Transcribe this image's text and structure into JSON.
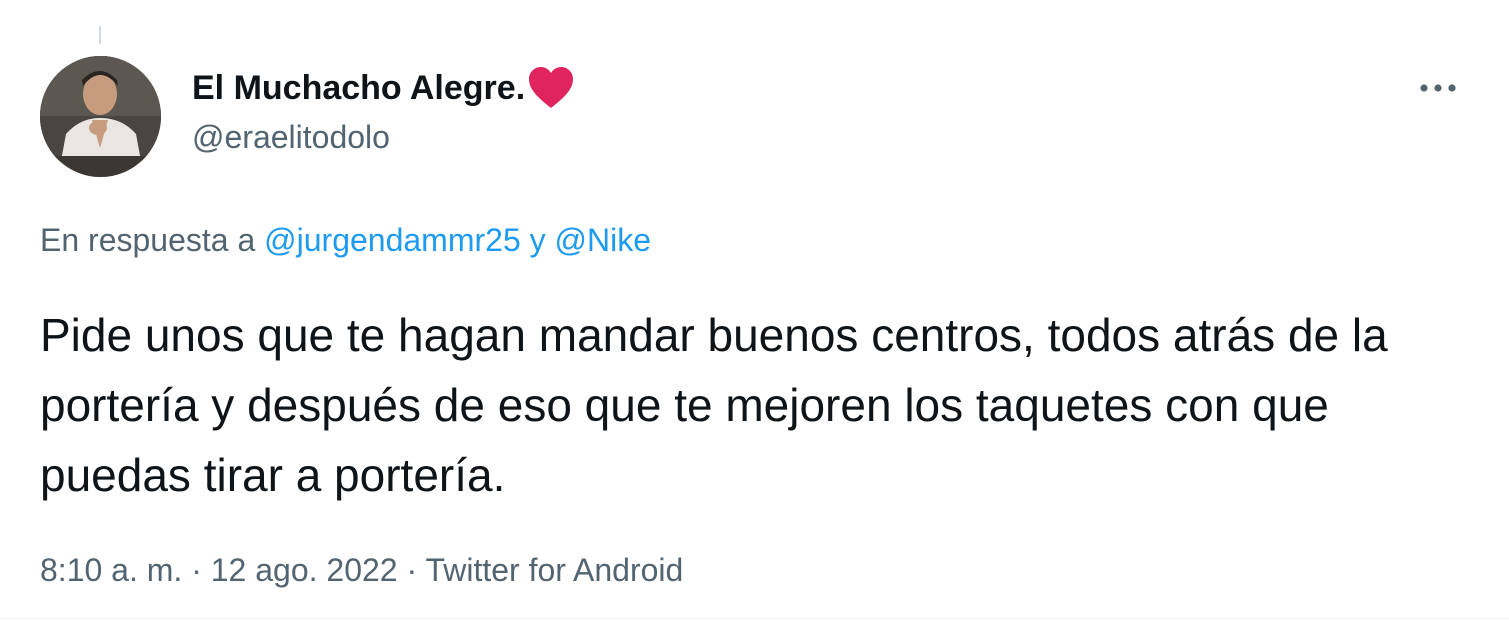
{
  "tweet": {
    "display_name": "El Muchacho Alegre.",
    "name_emoji": "red-heart-icon",
    "handle": "@eraelitodolo",
    "more_icon": "more-horizontal-icon",
    "reply": {
      "prefix": "En respuesta a",
      "mention_1": "@jurgendammr25",
      "connector": "y",
      "mention_2": "@Nike"
    },
    "text": "Pide unos que te hagan mandar buenos centros, todos atrás de la portería y después de eso que te mejoren los taquetes con que puedas tirar a portería.",
    "time": "8:10 a. m.",
    "date": "12 ago. 2022",
    "separator": "·",
    "source": "Twitter for Android"
  },
  "colors": {
    "text_primary": "#0f1419",
    "text_secondary": "#536471",
    "link": "#1d9bf0",
    "heart": "#e0245e"
  }
}
